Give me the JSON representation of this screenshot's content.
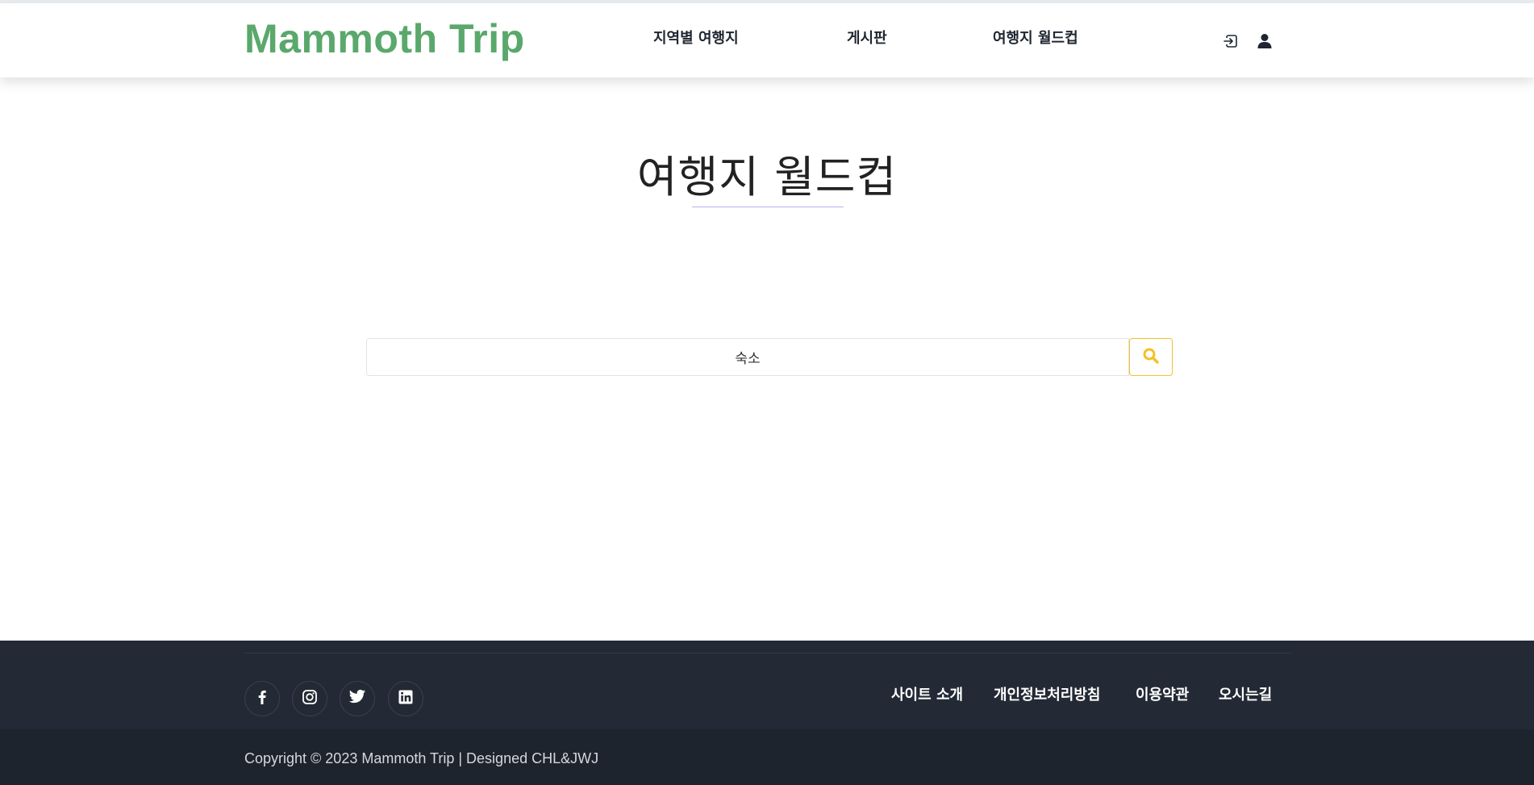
{
  "header": {
    "brand": "Mammoth Trip",
    "nav": [
      {
        "label": "지역별 여행지"
      },
      {
        "label": "게시판"
      },
      {
        "label": "여행지 월드컵"
      }
    ],
    "icons": [
      "login-icon",
      "user-icon"
    ]
  },
  "main": {
    "title": "여행지 월드컵",
    "search": {
      "value": "숙소",
      "button_icon": "search-icon"
    }
  },
  "footer": {
    "social": [
      "facebook-icon",
      "instagram-icon",
      "twitter-icon",
      "linkedin-icon"
    ],
    "links": [
      {
        "label": "사이트 소개"
      },
      {
        "label": "개인정보처리방침"
      },
      {
        "label": "이용약관"
      },
      {
        "label": "오시는길"
      }
    ],
    "copyright": "Copyright © 2023 Mammoth Trip | Designed CHL&JWJ"
  },
  "colors": {
    "brand": "#5aa86c",
    "accent": "#f4c027",
    "footer_bg": "#232a35",
    "copyright_bg": "#1e242e"
  }
}
